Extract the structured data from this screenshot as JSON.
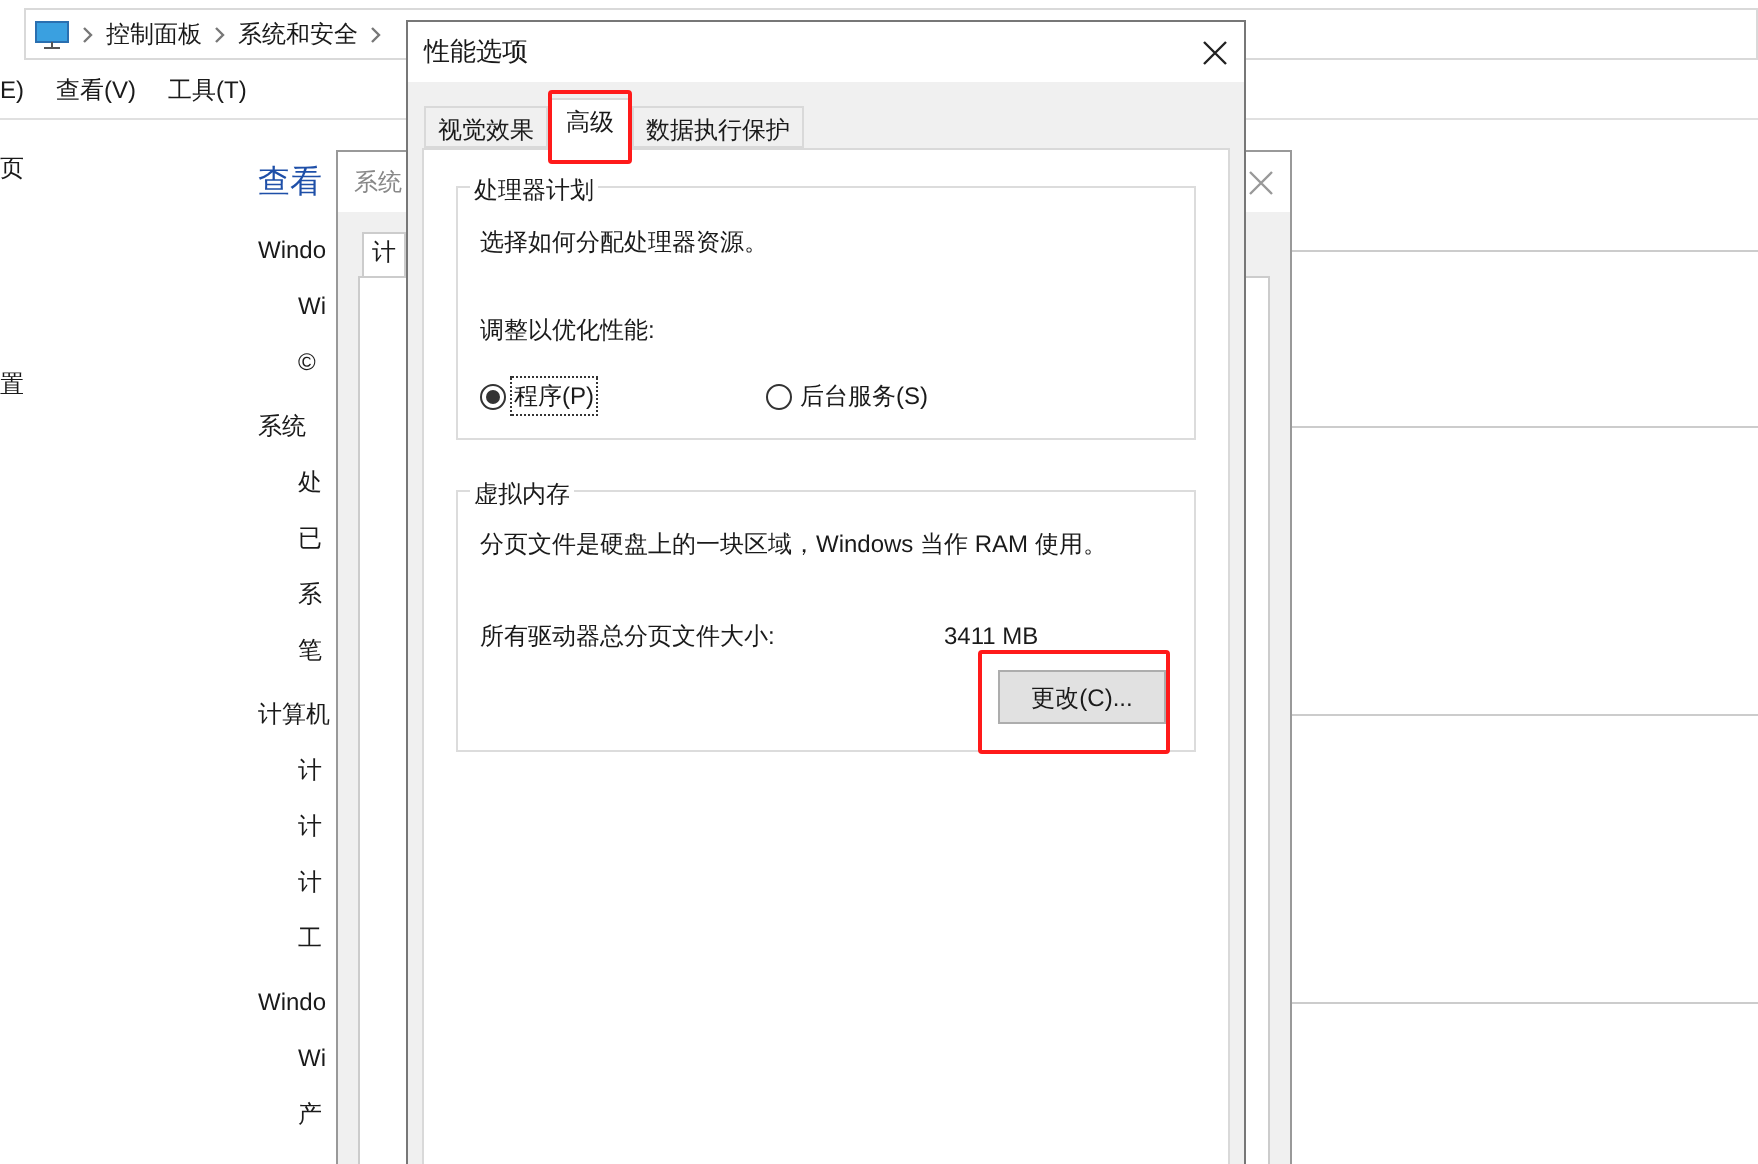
{
  "explorer": {
    "breadcrumb": [
      "控制面板",
      "系统和安全"
    ],
    "menu": [
      "E)",
      "查看(V)",
      "工具(T)"
    ],
    "nav": [
      "页",
      "置"
    ],
    "heading": "查看",
    "sections": [
      {
        "title": "Windo",
        "items": [
          "Wi",
          "©"
        ]
      },
      {
        "title": "系统",
        "items": [
          "处",
          "已",
          "系",
          "笔"
        ]
      },
      {
        "title": "计算机",
        "items": [
          "计",
          "计",
          "计",
          "工"
        ]
      },
      {
        "title": "Windo",
        "items": [
          "Wi",
          "产"
        ]
      }
    ]
  },
  "system_properties": {
    "title": "系统",
    "tabs": [
      {
        "label": "计",
        "selected": true
      }
    ]
  },
  "dialog": {
    "title": "性能选项",
    "tabs": [
      {
        "label": "视觉效果",
        "selected": false,
        "annotated": false
      },
      {
        "label": "高级",
        "selected": true,
        "annotated": true
      },
      {
        "label": "数据执行保护",
        "selected": false,
        "annotated": false
      }
    ],
    "processor": {
      "title": "处理器计划",
      "description": "选择如何分配处理器资源。",
      "adjust_label": "调整以优化性能:",
      "options": [
        {
          "label": "程序(P)",
          "selected": true,
          "focused": true
        },
        {
          "label": "后台服务(S)",
          "selected": false,
          "focused": false
        }
      ]
    },
    "virtual_memory": {
      "title": "虚拟内存",
      "description": "分页文件是硬盘上的一块区域，Windows 当作 RAM 使用。",
      "total_label": "所有驱动器总分页文件大小:",
      "total_value": "3411 MB",
      "button": {
        "label": "更改(C)...",
        "annotated": true
      }
    }
  }
}
